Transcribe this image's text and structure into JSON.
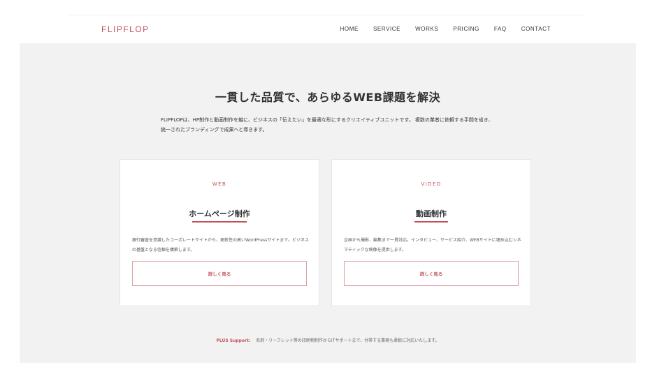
{
  "header": {
    "logo": "FLIPFLOP",
    "nav": [
      "HOME",
      "SERVICE",
      "WORKS",
      "PRICING",
      "FAQ",
      "CONTACT"
    ]
  },
  "main": {
    "headline": "一貫した品質で、あらゆるWEB課題を解決",
    "intro": "FLIPFLOPは、HP制作と動画制作を軸に、ビジネスの「伝えたい」を最適な形にするクリエイティブユニットです。 複数の業者に依頼する手間を省き、統一されたブランディングで成果へと導きます。",
    "cards": [
      {
        "tag": "WEB",
        "title": "ホームページ制作",
        "description": "銀行審査を意識したコーポレートサイトから、更新性の高いWordPressサイトまで。ビジネスの基盤となる信頼を構築します。",
        "button": "詳しく見る"
      },
      {
        "tag": "VIDEO",
        "title": "動画制作",
        "description": "企画から撮影、編集まで一貫対応。インタビュー、サービス紹介、WEBサイトに埋め込むシネマティックな映像を提供します。",
        "button": "詳しく見る"
      }
    ],
    "support": {
      "label": "PLUS Support:",
      "text": "名刺・リーフレット等の印刷物制作からITサポートまで、付帯する業務も柔軟に対応いたします。"
    }
  },
  "colors": {
    "accent": "#c0535a",
    "background": "#f2f2f2",
    "card": "#ffffff"
  }
}
